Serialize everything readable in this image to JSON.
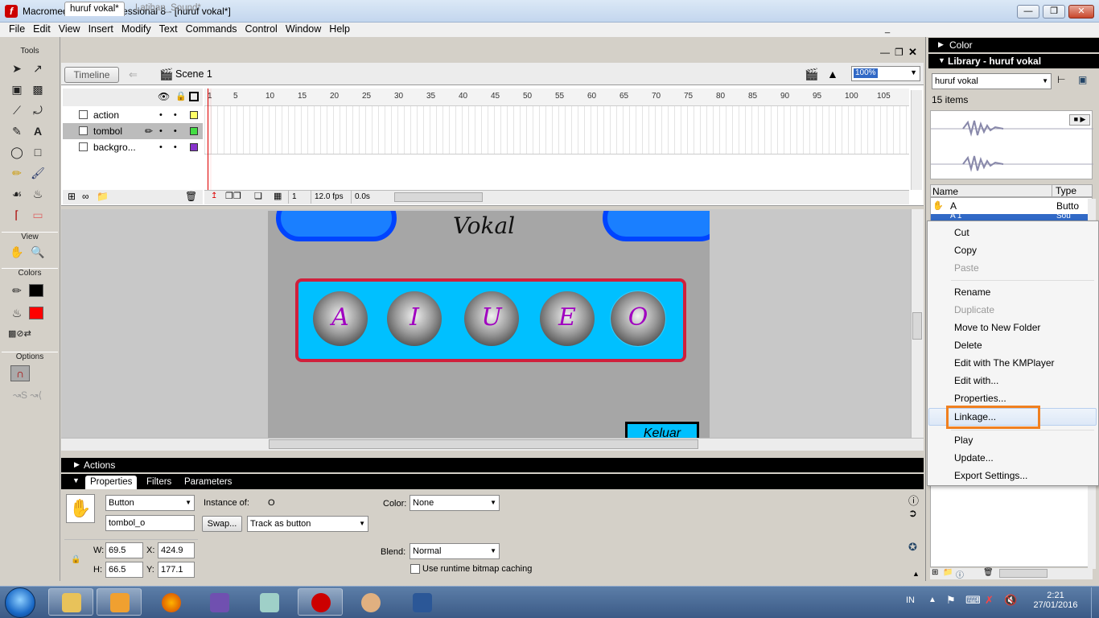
{
  "window": {
    "title": "Macromedia Flash Professional 8 - [huruf vokal*]",
    "app_icon": "f"
  },
  "menu": [
    "File",
    "Edit",
    "View",
    "Insert",
    "Modify",
    "Text",
    "Commands",
    "Control",
    "Window",
    "Help"
  ],
  "tools": {
    "title": "Tools",
    "view_title": "View",
    "colors_title": "Colors",
    "options_title": "Options"
  },
  "doc_tabs": {
    "active": "huruf vokal*",
    "inactive": "Latihan_Sound*"
  },
  "editbar": {
    "timeline": "Timeline",
    "scene": "Scene 1",
    "zoom": "100%"
  },
  "timeline": {
    "layers": [
      {
        "name": "action",
        "color": "#ffff66"
      },
      {
        "name": "tombol",
        "color": "#44dd44"
      },
      {
        "name": "backgro...",
        "color": "#8833cc"
      }
    ],
    "ruler": [
      "1",
      "5",
      "10",
      "15",
      "20",
      "25",
      "30",
      "35",
      "40",
      "45",
      "50",
      "55",
      "60",
      "65",
      "70",
      "75",
      "80",
      "85",
      "90",
      "95",
      "100",
      "105"
    ],
    "frame": "1",
    "fps": "12.0 fps",
    "time": "0.0s"
  },
  "stage": {
    "title": "Vokal",
    "buttons": [
      "A",
      "I",
      "U",
      "E",
      "O"
    ],
    "keluar": "Keluar"
  },
  "actions_panel": {
    "title": "Actions"
  },
  "properties": {
    "tabs": [
      "Properties",
      "Filters",
      "Parameters"
    ],
    "symbol_type": "Button",
    "instance_name": "tombol_o",
    "instance_of_label": "Instance of:",
    "instance_of": "O",
    "swap": "Swap...",
    "track": "Track as button",
    "color_label": "Color:",
    "color_value": "None",
    "w_label": "W:",
    "w": "69.5",
    "x_label": "X:",
    "x": "424.9",
    "h_label": "H:",
    "h": "66.5",
    "y_label": "Y:",
    "y": "177.1",
    "blend_label": "Blend:",
    "blend": "Normal",
    "bitmap_caching": "Use runtime bitmap caching"
  },
  "right_panels": {
    "color_title": "Color",
    "library_title": "Library - huruf vokal",
    "library_select": "huruf vokal",
    "items_count": "15 items",
    "col_name": "Name",
    "col_type": "Type",
    "row_a_name": "A",
    "row_a_type": "Butto",
    "row_sel_name": "A 1",
    "row_sel_type": "Sou"
  },
  "context_menu": {
    "items": [
      {
        "label": "Cut",
        "enabled": true
      },
      {
        "label": "Copy",
        "enabled": true
      },
      {
        "label": "Paste",
        "enabled": false
      },
      {
        "label": "Rename",
        "enabled": true
      },
      {
        "label": "Duplicate",
        "enabled": false
      },
      {
        "label": "Move to New Folder",
        "enabled": true
      },
      {
        "label": "Delete",
        "enabled": true
      },
      {
        "label": "Edit with The KMPlayer",
        "enabled": true
      },
      {
        "label": "Edit with...",
        "enabled": true
      },
      {
        "label": "Properties...",
        "enabled": true
      },
      {
        "label": "Linkage...",
        "enabled": true
      },
      {
        "label": "Play",
        "enabled": true
      },
      {
        "label": "Update...",
        "enabled": true
      },
      {
        "label": "Export Settings...",
        "enabled": true
      }
    ]
  },
  "taskbar": {
    "lang": "IN",
    "time": "2:21",
    "date": "27/01/2016"
  },
  "colors": {
    "accent_highlight": "#f08020",
    "stage_panel": "#00c0ff",
    "selection": "#3169c6"
  }
}
